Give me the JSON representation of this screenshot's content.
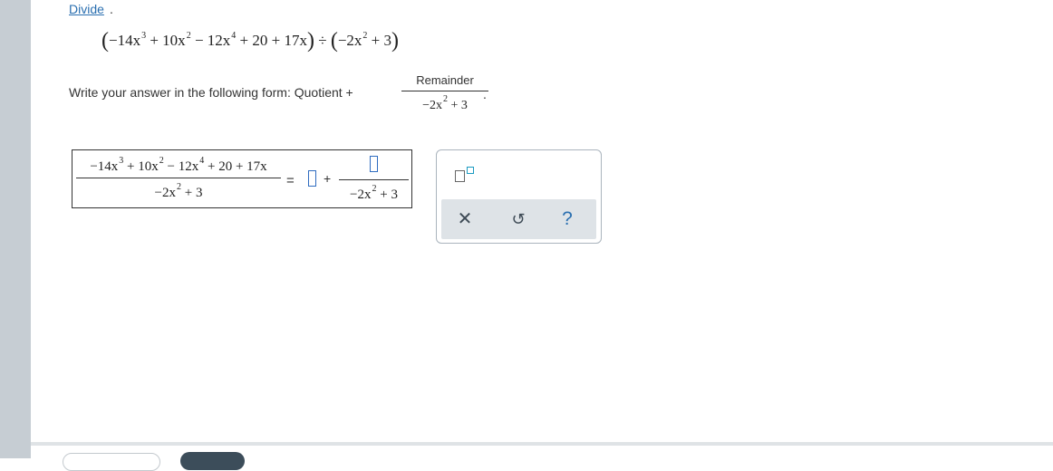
{
  "header": {
    "divide_link": "Divide",
    "divide_period": "."
  },
  "problem": {
    "open_paren": "(",
    "close_paren": ")",
    "t1_coef": "−14x",
    "t1_exp": "3",
    "t2_coef": " + 10x",
    "t2_exp": "2",
    "t3_coef": " − 12x",
    "t3_exp": "4",
    "t4": " + 20 + 17x",
    "divide_sign": " ÷ ",
    "d1_coef": "−2x",
    "d1_exp": "2",
    "d2": " + 3"
  },
  "instructions": {
    "text": "Write your answer in the following form: Quotient +",
    "remainder_label": "Remainder",
    "den_coef": "−2x",
    "den_exp": "2",
    "den_rest": " + 3",
    "period": "."
  },
  "answer": {
    "num_t1": "−14x",
    "num_t1_exp": "3",
    "num_t2": " + 10x",
    "num_t2_exp": "2",
    "num_t3": " − 12x",
    "num_t3_exp": "4",
    "num_t4": " + 20 + 17x",
    "den_coef": "−2x",
    "den_exp": "2",
    "den_rest": " + 3",
    "equals": "=",
    "quotient_value": "",
    "plus": "+",
    "remainder_value": "",
    "r_den_coef": "−2x",
    "r_den_exp": "2",
    "r_den_rest": "  + 3"
  },
  "tools": {
    "fraction_tool_icon": "fraction-template-icon",
    "clear_icon": "close-icon",
    "clear_glyph": "✕",
    "undo_icon": "undo-icon",
    "undo_glyph": "↺",
    "help_icon": "help-icon",
    "help_glyph": "?"
  },
  "colors": {
    "link": "#2a6fb0",
    "input_border": "#2f6cc0",
    "tool_bar": "#dee3e7"
  }
}
